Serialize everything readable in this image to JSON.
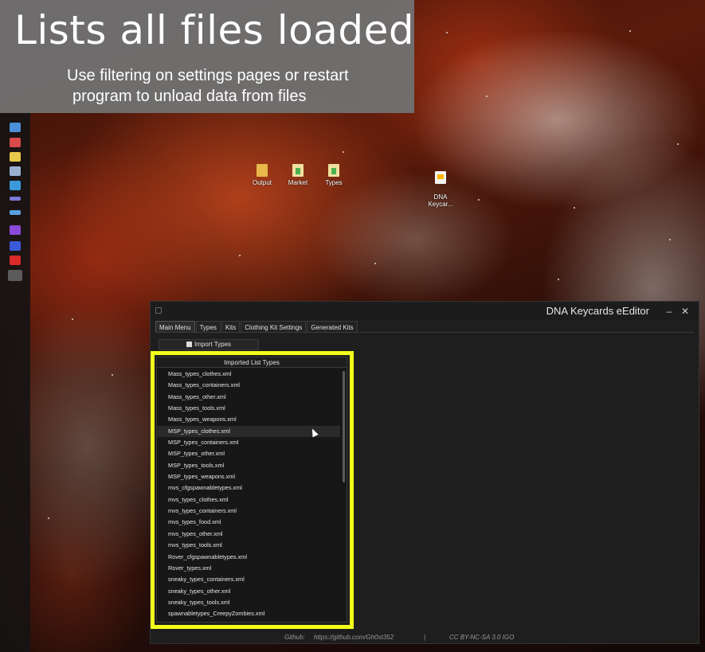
{
  "banner": {
    "title": "Lists all files loaded",
    "subtitle_line1": "Use filtering on settings pages or restart",
    "subtitle_line2": "program to unload data from files"
  },
  "desktop": {
    "icons": [
      {
        "label": "Output",
        "icon": "folder-icon"
      },
      {
        "label": "Market",
        "icon": "folder-sheet-icon"
      },
      {
        "label": "Types",
        "icon": "folder-sheet-icon"
      },
      {
        "label": "DNA\nKeycar...",
        "icon": "app-doc-icon"
      }
    ]
  },
  "window": {
    "title": "DNA Keycards eEditor",
    "minimize_glyph": "–",
    "close_glyph": "✕",
    "tabs": [
      {
        "label": "Main Menu",
        "active": true
      },
      {
        "label": "Types",
        "active": false
      },
      {
        "label": "Kits",
        "active": false
      },
      {
        "label": "Clothing Kit Settings",
        "active": false
      },
      {
        "label": "Generated Kits",
        "active": false
      }
    ],
    "import_button": "Import Types",
    "list": {
      "header": "Imported List Types",
      "items": [
        "Mass_types_clothes.xml",
        "Mass_types_containers.xml",
        "Mass_types_other.xml",
        "Mass_types_tools.xml",
        "Mass_types_weapons.xml",
        "MSP_types_clothes.xml",
        "MSP_types_containers.xml",
        "MSP_types_other.xml",
        "MSP_types_tools.xml",
        "MSP_types_weapons.xml",
        "mvs_cfgspawnabletypes.xml",
        "mvs_types_clothes.xml",
        "mvs_types_containers.xml",
        "mvs_types_food.xml",
        "mvs_types_other.xml",
        "mvs_types_tools.xml",
        "Rover_cfgspawnabletypes.xml",
        "Rover_types.xml",
        "sneaky_types_containers.xml",
        "sneaky_types_other.xml",
        "sneaky_types_tools.xml",
        "spawnabletypes_CreepyZombies.xml"
      ],
      "hovered_index": 5
    },
    "footer": {
      "github_label": "Github:",
      "github_url": "https://github.com/Gh0st352",
      "separator": "|",
      "license": "CC BY-NC-SA 3.0 IGO"
    }
  },
  "colors": {
    "highlight": "#f2ff1a",
    "window_bg": "#1e1e1e",
    "banner_bg": "#707070"
  }
}
